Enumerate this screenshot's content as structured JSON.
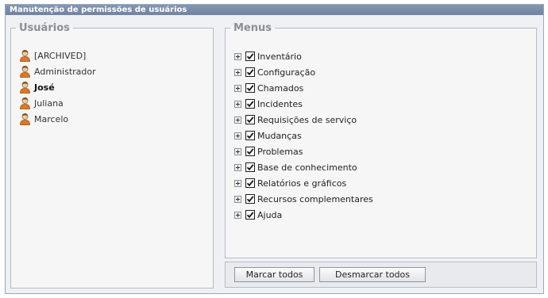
{
  "window": {
    "title": "Manutenção de permissões de usuários"
  },
  "users_panel": {
    "legend": "Usuários",
    "items": [
      {
        "label": "[ARCHIVED]",
        "icon": "user-icon",
        "selected": false
      },
      {
        "label": "Administrador",
        "icon": "user-icon",
        "selected": false
      },
      {
        "label": "José",
        "icon": "user-icon",
        "selected": true
      },
      {
        "label": "Juliana",
        "icon": "user-icon",
        "selected": false
      },
      {
        "label": "Marcelo",
        "icon": "user-icon",
        "selected": false
      }
    ]
  },
  "menus_panel": {
    "legend": "Menus",
    "items": [
      {
        "label": "Inventário",
        "checked": true
      },
      {
        "label": "Configuração",
        "checked": true
      },
      {
        "label": "Chamados",
        "checked": true
      },
      {
        "label": "Incidentes",
        "checked": true
      },
      {
        "label": "Requisições de serviço",
        "checked": true
      },
      {
        "label": "Mudanças",
        "checked": true
      },
      {
        "label": "Problemas",
        "checked": true
      },
      {
        "label": "Base de conhecimento",
        "checked": true
      },
      {
        "label": "Relatórios e gráficos",
        "checked": true
      },
      {
        "label": "Recursos complementares",
        "checked": true
      },
      {
        "label": "Ajuda",
        "checked": true
      }
    ]
  },
  "buttons": {
    "mark_all": "Marcar todos",
    "unmark_all": "Desmarcar todos"
  },
  "colors": {
    "titlebar": "#7488a6",
    "legend": "#8a8f96",
    "panel_border": "#b7bdc6",
    "user_icon_shirt": "#e5751f",
    "user_icon_face": "#f3c99a"
  }
}
